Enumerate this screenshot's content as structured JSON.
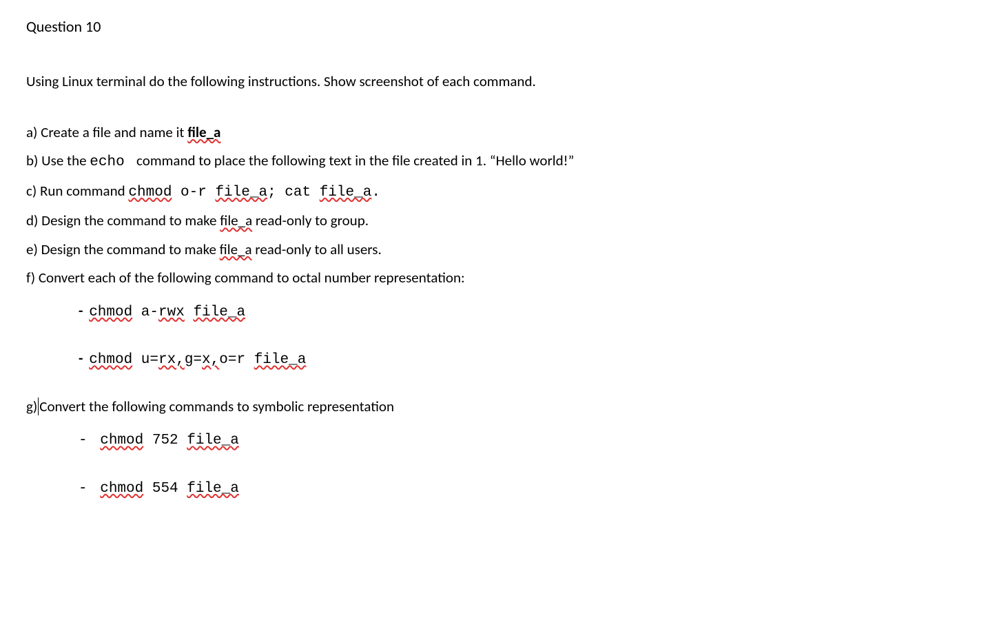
{
  "heading": "Question 10",
  "intro": "Using Linux terminal do the following instructions. Show screenshot of each command.",
  "a": {
    "prefix": "a) Create a file and name it ",
    "file": "file_a"
  },
  "b": {
    "t1": "b) Use the ",
    "echo": "echo ",
    "t2": " command to place the following text in the file created in 1. “Hello world!”"
  },
  "c": {
    "t1": "c) Run command ",
    "cmd1": "chmod",
    "sp1": " o-r ",
    "cmd2": "file_a",
    "sp2": "; cat ",
    "cmd3": "file_a",
    "dot": "."
  },
  "d": {
    "t1": "d) Design the command to make ",
    "fa": "file_a",
    "t2": " read-only to group."
  },
  "e": {
    "t1": "e) Design the command to make ",
    "fa": "file_a",
    "t2": " read-only to all users."
  },
  "f": {
    "t1": "f) Convert each of the following command to octal number representation:",
    "row1": {
      "chmod": "chmod",
      "mid": " a-",
      "rwx": "rwx",
      "sp": " ",
      "file": "file_a"
    },
    "row2": {
      "chmod": "chmod",
      "t1": " u=",
      "rx": "rx,",
      "t2": "g=",
      "x": "x,",
      "t3": "o=r ",
      "file": "file_a"
    }
  },
  "g": {
    "label": "g)",
    "t1": "Convert the following commands to symbolic representation",
    "row1": {
      "dash": "- ",
      "chmod": "chmod",
      "mid": " 752 ",
      "file": "file_a"
    },
    "row2": {
      "dash": "- ",
      "chmod": "chmod",
      "mid": " 554 ",
      "file": "file_a"
    }
  },
  "bullets": {
    "bold_dash": "- "
  }
}
